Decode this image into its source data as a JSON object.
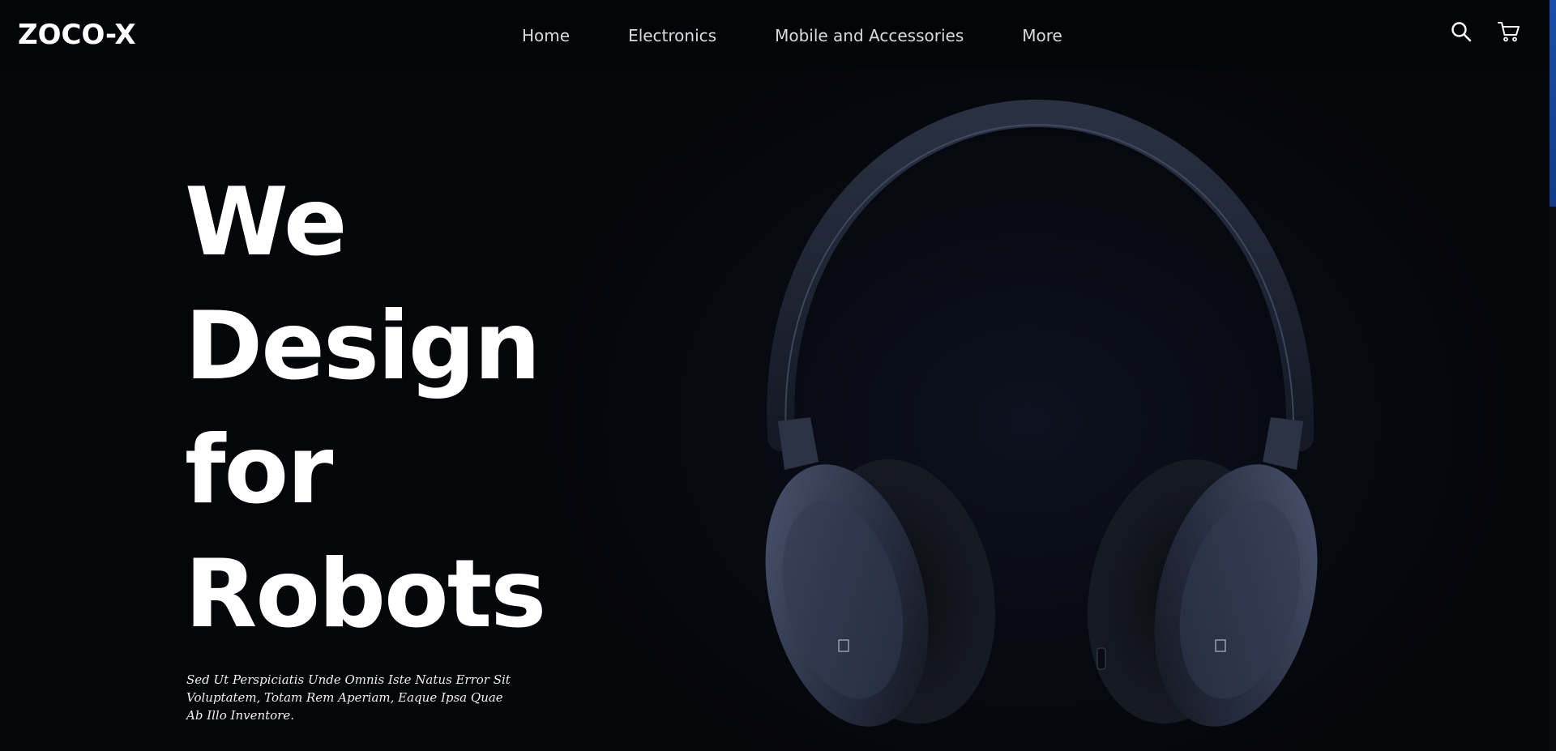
{
  "brand": {
    "name": "ZOCO-X"
  },
  "nav": {
    "items": [
      {
        "label": "Home"
      },
      {
        "label": "Electronics"
      },
      {
        "label": "Mobile and Accessories"
      },
      {
        "label": "More"
      }
    ]
  },
  "header_icons": {
    "search": "search-icon",
    "cart": "cart-icon"
  },
  "hero": {
    "title_lines": [
      "We",
      "Design",
      "for",
      "Robots"
    ],
    "subtitle": "Sed Ut Perspiciatis Unde Omnis Iste Natus Error Sit Voluptatem, Totam Rem Aperiam, Eaque Ipsa Quae Ab Illo Inventore."
  },
  "image": {
    "subject": "headphones-image"
  },
  "colors": {
    "background": "#05060a",
    "text": "#ffffff",
    "nav_text": "#d9dbe0",
    "scroll_thumb": "#1a4ea8"
  }
}
